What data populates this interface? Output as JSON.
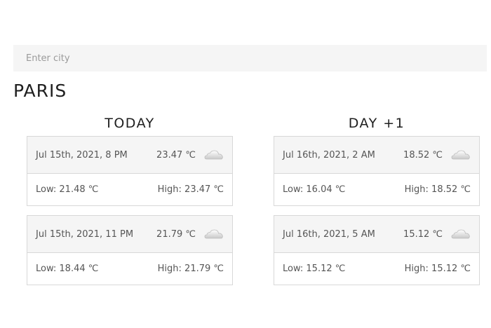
{
  "search": {
    "placeholder": "Enter city",
    "value": ""
  },
  "city": {
    "name": "PARIS"
  },
  "columns": [
    {
      "heading": "TODAY",
      "cards": [
        {
          "datetime": "Jul 15th, 2021, 8 PM",
          "temp": "23.47 ℃",
          "icon": "cloud-icon",
          "low": "Low: 21.48 ℃",
          "high": "High: 23.47 ℃"
        },
        {
          "datetime": "Jul 15th, 2021, 11 PM",
          "temp": "21.79 ℃",
          "icon": "cloud-icon",
          "low": "Low: 18.44 ℃",
          "high": "High: 21.79 ℃"
        }
      ]
    },
    {
      "heading": "DAY +1",
      "cards": [
        {
          "datetime": "Jul 16th, 2021, 2 AM",
          "temp": "18.52 ℃",
          "icon": "cloud-icon",
          "low": "Low: 16.04 ℃",
          "high": "High: 18.52 ℃"
        },
        {
          "datetime": "Jul 16th, 2021, 5 AM",
          "temp": "15.12 ℃",
          "icon": "cloud-icon",
          "low": "Low: 15.12 ℃",
          "high": "High: 15.12 ℃"
        }
      ]
    }
  ],
  "colors": {
    "search_bg": "#f5f5f5",
    "card_header_bg": "#f5f5f5",
    "card_border": "#d8d8d8",
    "text": "#555555",
    "heading": "#1f1f1f"
  }
}
